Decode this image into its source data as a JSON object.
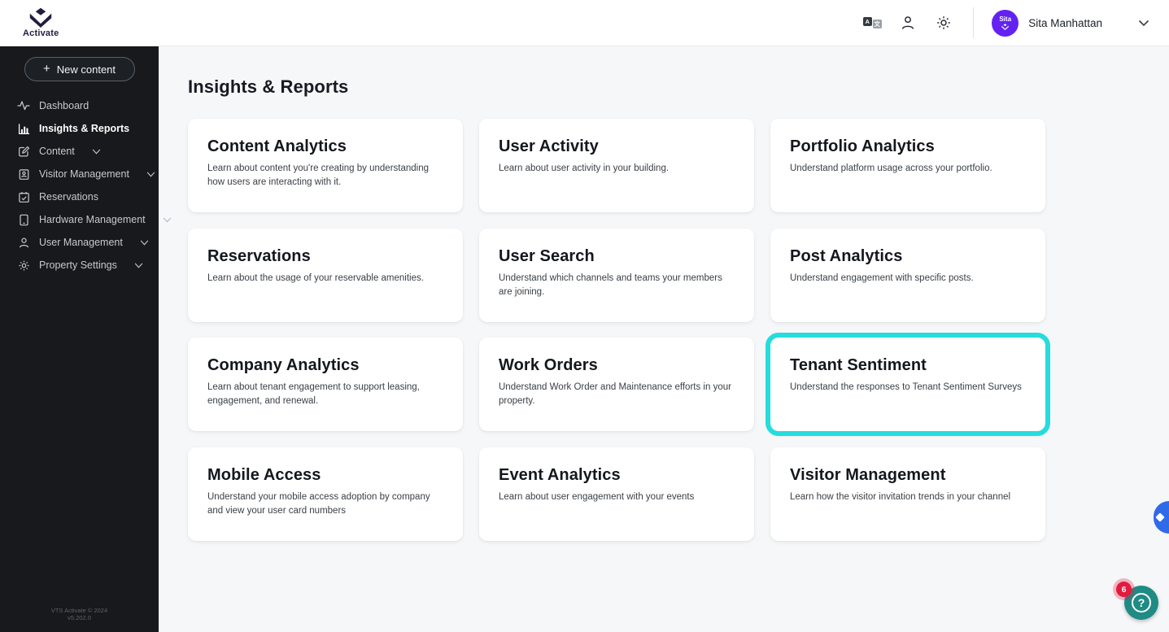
{
  "header": {
    "logo_text": "Activate",
    "avatar_text": "Sita",
    "user_name": "Sita Manhattan"
  },
  "sidebar": {
    "new_content_label": "New content",
    "items": [
      {
        "label": "Dashboard",
        "icon": "activity",
        "expandable": false,
        "active": false
      },
      {
        "label": "Insights & Reports",
        "icon": "bar-chart",
        "expandable": false,
        "active": true
      },
      {
        "label": "Content",
        "icon": "edit",
        "expandable": true,
        "active": false
      },
      {
        "label": "Visitor Management",
        "icon": "badge",
        "expandable": true,
        "active": false
      },
      {
        "label": "Reservations",
        "icon": "calendar-check",
        "expandable": false,
        "active": false
      },
      {
        "label": "Hardware Management",
        "icon": "tablet",
        "expandable": true,
        "active": false
      },
      {
        "label": "User Management",
        "icon": "person",
        "expandable": true,
        "active": false
      },
      {
        "label": "Property Settings",
        "icon": "gear",
        "expandable": true,
        "active": false
      }
    ],
    "footer_line1": "VTS Activate © 2024",
    "footer_line2": "v5.202.0"
  },
  "main": {
    "title": "Insights & Reports",
    "cards": [
      {
        "title": "Content Analytics",
        "description": "Learn about content you're creating by understanding how users are interacting with it.",
        "highlighted": false
      },
      {
        "title": "User Activity",
        "description": "Learn about user activity in your building.",
        "highlighted": false
      },
      {
        "title": "Portfolio Analytics",
        "description": "Understand platform usage across your portfolio.",
        "highlighted": false
      },
      {
        "title": "Reservations",
        "description": "Learn about the usage of your reservable amenities.",
        "highlighted": false
      },
      {
        "title": "User Search",
        "description": "Understand which channels and teams your members are joining.",
        "highlighted": false
      },
      {
        "title": "Post Analytics",
        "description": "Understand engagement with specific posts.",
        "highlighted": false
      },
      {
        "title": "Company Analytics",
        "description": "Learn about tenant engagement to support leasing, engagement, and renewal.",
        "highlighted": false
      },
      {
        "title": "Work Orders",
        "description": "Understand Work Order and Maintenance efforts in your property.",
        "highlighted": false
      },
      {
        "title": "Tenant Sentiment",
        "description": "Understand the responses to Tenant Sentiment Surveys",
        "highlighted": true
      },
      {
        "title": "Mobile Access",
        "description": "Understand your mobile access adoption by company and view your user card numbers",
        "highlighted": false
      },
      {
        "title": "Event Analytics",
        "description": "Learn about user engagement with your events",
        "highlighted": false
      },
      {
        "title": "Visitor Management",
        "description": "Learn how the visitor invitation trends in your channel",
        "highlighted": false
      }
    ]
  },
  "floating": {
    "help_badge_count": "6",
    "help_icon": "?"
  },
  "colors": {
    "highlight": "#26DCDC",
    "sidebar_bg": "#17191C",
    "avatar_bg": "#6322F2",
    "help_bg": "#1E8B84",
    "badge_bg": "#E4193E",
    "handle_bg": "#2F6AE8"
  }
}
